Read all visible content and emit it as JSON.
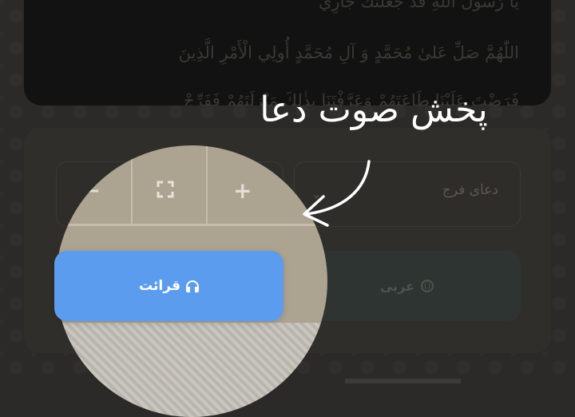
{
  "dua_text": {
    "line_0": "يَا رَسُولَ اللّٰهِ قَدْ جَعَلْتُكَ جَارِي",
    "line_1": "اللّٰهُمَّ صَلِّ عَلىٰ مُحَمَّدٍ وَ آلِ مُحَمَّدٍ أُولِي الْأَمْرِ الَّذِينَ",
    "line_2": "فَرَضْتَ عَلَيْنَا طَاعَتَهُمْ وَعَرَّفْتَنَا بِذٰلِكَ مَنْزِلَتَهُمْ فَفَرِّجْ"
  },
  "zoom_controls": {
    "minus_label": "−",
    "plus_label": "+",
    "fullscreen_icon": "fullscreen-icon"
  },
  "dua_select": {
    "value": "دعای فرج",
    "chevron": "⌄"
  },
  "buttons": {
    "play_label": "قرائت",
    "play_icon": "headphones-icon",
    "language_label": "عربی",
    "language_icon": "globe-icon"
  },
  "annotation": {
    "text": "پخش صوت دعا"
  },
  "colors": {
    "play_button": "#5c9cee",
    "language_button": "#2e3431",
    "background": "#2b2a28",
    "panel": "#121212"
  }
}
